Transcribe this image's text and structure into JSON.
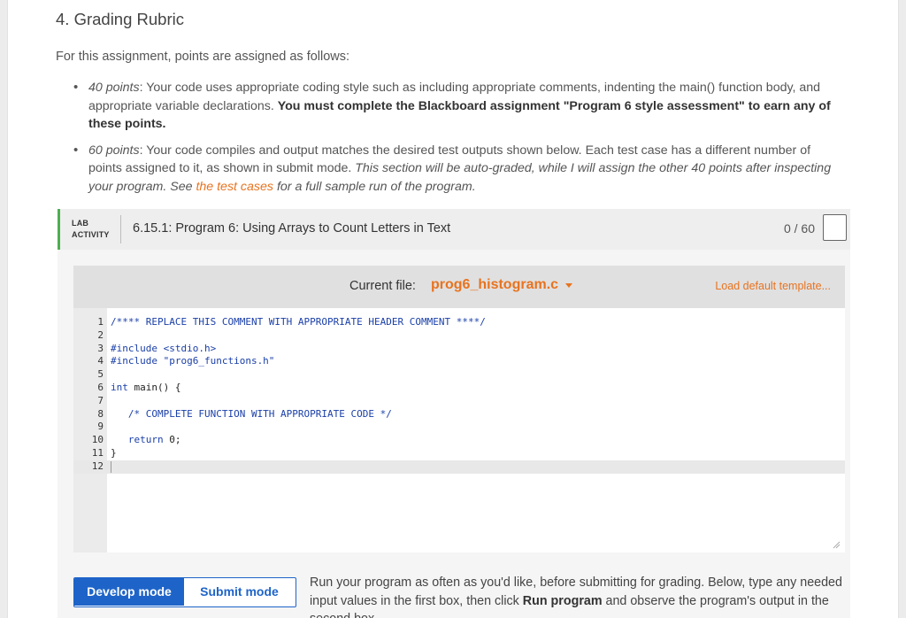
{
  "section": {
    "title": "4. Grading Rubric",
    "intro": "For this assignment, points are assigned as follows:"
  },
  "rubric": {
    "item1": {
      "points": "40 points",
      "text": ": Your code uses appropriate coding style such as including appropriate comments, indenting the main() function body, and appropriate variable declarations. ",
      "bold": "You must complete the Blackboard assignment \"Program 6 style assessment\" to earn any of these points."
    },
    "item2": {
      "points": "60 points",
      "text": ": Your code compiles and output matches the desired test outputs shown below. Each test case has a different number of points assigned to it, as shown in submit mode. ",
      "italic_a": "This section will be auto-graded, while I will assign the other 40 points after inspecting your program. See ",
      "link": "the test cases",
      "italic_b": " for a full sample run of the program."
    }
  },
  "lab": {
    "tag_line1": "LAB",
    "tag_line2": "ACTIVITY",
    "title": "6.15.1: Program 6: Using Arrays to Count Letters in Text",
    "score": "0 / 60",
    "current_file_label": "Current file:",
    "current_file": "prog6_histogram.c",
    "load_template": "Load default template...",
    "modes": {
      "develop": "Develop mode",
      "submit": "Submit mode"
    },
    "run_help_a": "Run your program as often as you'd like, before submitting for grading. Below, type any needed input values in the first box, then click ",
    "run_help_bold": "Run program",
    "run_help_b": " and observe the program's output in the second box."
  },
  "editor": {
    "lines": [
      {
        "n": "1",
        "code": "/**** REPLACE THIS COMMENT WITH APPROPRIATE HEADER COMMENT ****/"
      },
      {
        "n": "2",
        "code": ""
      },
      {
        "n": "3",
        "code": "#include <stdio.h>"
      },
      {
        "n": "4",
        "code": "#include \"prog6_functions.h\""
      },
      {
        "n": "5",
        "code": ""
      },
      {
        "n": "6",
        "code": "int main() {"
      },
      {
        "n": "7",
        "code": ""
      },
      {
        "n": "8",
        "code": "   /* COMPLETE FUNCTION WITH APPROPRIATE CODE */"
      },
      {
        "n": "9",
        "code": ""
      },
      {
        "n": "10",
        "code": "   return 0;"
      },
      {
        "n": "11",
        "code": "}"
      },
      {
        "n": "12",
        "code": ""
      }
    ]
  },
  "colors": {
    "accent_orange": "#e8731f",
    "mode_blue": "#1e64c8",
    "lab_green": "#4caf50",
    "code_blue": "#1a3fa8"
  }
}
